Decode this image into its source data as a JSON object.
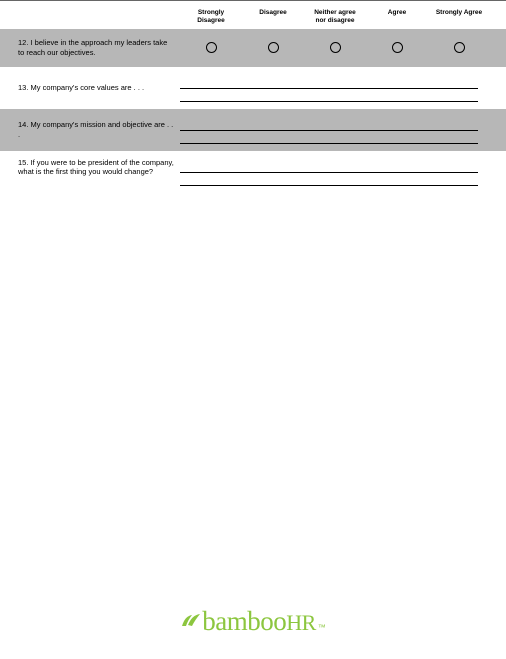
{
  "scale": {
    "c1": "Strongly Disagree",
    "c2": "Disagree",
    "c3": "Neither agree nor disagree",
    "c4": "Agree",
    "c5": "Strongly Agree"
  },
  "questions": {
    "q12": "12. I believe in the approach my leaders take to reach our objectives.",
    "q13": "13. My company's core values are . . .",
    "q14": "14. My company's mission and objective are . . .",
    "q15": "15. If you were to be president of the company, what is the first thing you would change?"
  },
  "brand": {
    "name_part1": "bamboo",
    "name_part2": "HR",
    "tm": "™"
  }
}
